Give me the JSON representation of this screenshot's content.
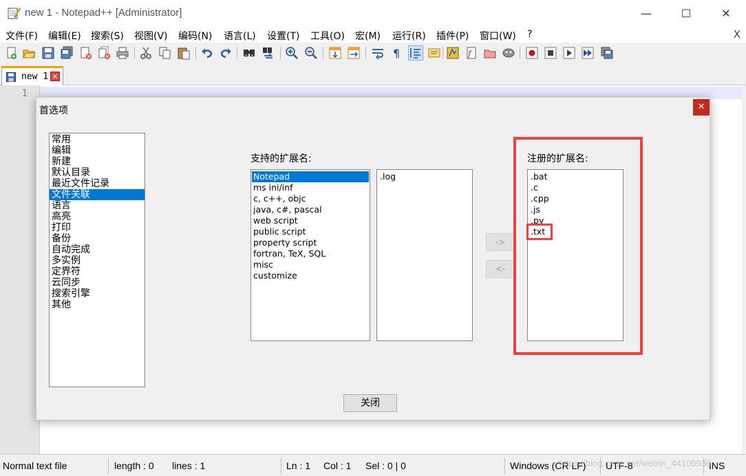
{
  "window": {
    "title": "new 1 - Notepad++ [Administrator]",
    "min_glyph": "—",
    "max_glyph": "☐",
    "close_glyph": "✕"
  },
  "menu": {
    "items": [
      "文件(F)",
      "编辑(E)",
      "搜索(S)",
      "视图(V)",
      "编码(N)",
      "语言(L)",
      "设置(T)",
      "工具(O)",
      "宏(M)",
      "运行(R)",
      "插件(P)",
      "窗口(W)",
      "?"
    ],
    "close_glyph": "X"
  },
  "toolbar": {
    "icons": [
      "new-file-icon",
      "open-file-icon",
      "save-icon",
      "save-all-icon",
      "close-icon",
      "close-all-icon",
      "print-icon",
      "cut-icon",
      "copy-icon",
      "paste-icon",
      "undo-icon",
      "redo-icon",
      "find-icon",
      "replace-icon",
      "zoom-in-icon",
      "zoom-out-icon",
      "sync-vertical-icon",
      "sync-horizontal-icon",
      "word-wrap-icon",
      "show-all-chars-icon",
      "indent-guide-icon",
      "doc-map-icon",
      "function-list-icon",
      "folder-workspace-icon",
      "doc-list-icon",
      "monitoring-icon",
      "record-macro-icon",
      "stop-record-icon",
      "playback-icon",
      "run-macro-multiple-icon",
      "save-macro-icon"
    ]
  },
  "tab": {
    "label": "new 1",
    "close_glyph": "✕"
  },
  "editor": {
    "line_number": "1"
  },
  "status": {
    "file_type": "Normal text file",
    "length": "length : 0",
    "lines": "lines : 1",
    "ln": "Ln : 1",
    "col": "Col : 1",
    "sel": "Sel : 0 | 0",
    "eol": "Windows (CR LF)",
    "encoding": "UTF-8",
    "mode": "INS",
    "watermark": "https://blog.csdn.net/weixin_44109936"
  },
  "dialog": {
    "title": "首选项",
    "close_glyph": "✕",
    "categories": [
      "常用",
      "编辑",
      "新建",
      "默认目录",
      "最近文件记录",
      "文件关联",
      "语言",
      "高亮",
      "打印",
      "备份",
      "自动完成",
      "多实例",
      "定界符",
      "云同步",
      "搜索引擎",
      "其他"
    ],
    "selected_category": "文件关联",
    "supported_label": "支持的扩展名:",
    "languages": [
      "Notepad",
      "ms ini/inf",
      "c, c++, objc",
      "java, c#, pascal",
      "web script",
      "public script",
      "property script",
      "fortran, TeX, SQL",
      "misc",
      "customize"
    ],
    "selected_language": "Notepad",
    "extensions": [
      ".log"
    ],
    "add_button": "->",
    "remove_button": "<-",
    "registered_label": "注册的扩展名:",
    "registered": [
      ".bat",
      ".c",
      ".cpp",
      ".js",
      ".py",
      ".txt"
    ],
    "close_button": "关闭"
  },
  "colors": {
    "selection": "#0078d7",
    "annotation": "#f04040",
    "dialog_close": "#c42b1c"
  }
}
